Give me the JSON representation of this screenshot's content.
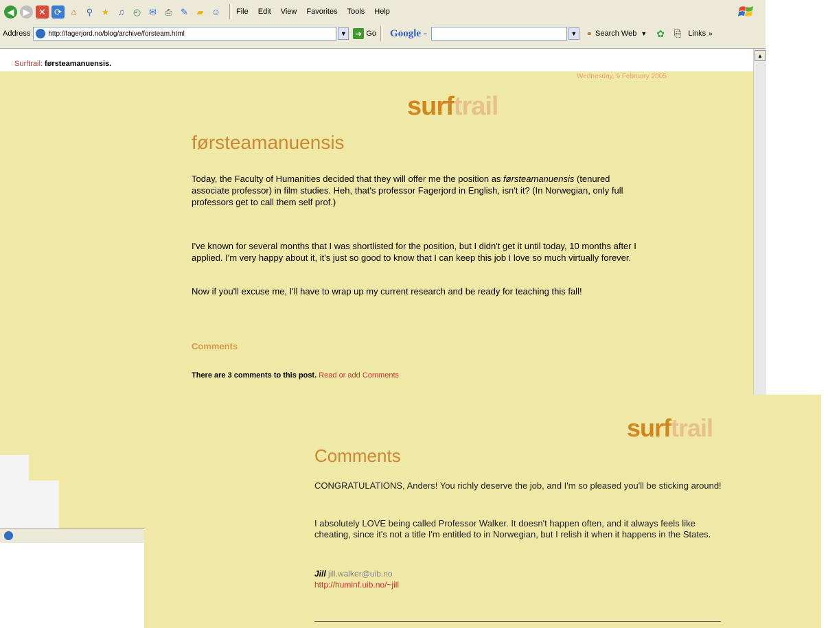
{
  "browser": {
    "menu": [
      "File",
      "Edit",
      "View",
      "Favorites",
      "Tools",
      "Help"
    ],
    "address_label": "Address",
    "address_url": "http://fagerjord.no/blog/archive/forsteam.html",
    "go_label": "Go",
    "google_label": "Google -",
    "search_web_label": "Search Web",
    "links_label": "Links"
  },
  "page": {
    "breadcrumb_site": "Surftrail:",
    "breadcrumb_page": "førsteamanuensis.",
    "date": "Wednesday, 9 February 2005",
    "logo_part1": "surf",
    "logo_part2": "trail",
    "post_title": "førsteamanuensis",
    "p1_before": "Today, the Faculty of Humanities decided that they will offer me the position as ",
    "p1_italic": "førsteamanuensis",
    "p1_after": " (tenured associate professor) in film studies. Heh, that's professor Fagerjord in English, isn't it? (In Norwegian, only full professors get to call them self prof.)",
    "p2": "I've known for several months that I was shortlisted for the position, but I didn't get it until today, 10 months after I applied. I'm very happy about it, it's just so good to know that I can keep this job I love so much virtually forever.",
    "p3": "Now if you'll excuse me, I'll have to wrap up my current research and be ready for teaching this fall!",
    "comments_heading": "Comments",
    "comment_count_text": "There are 3 comments to this post.",
    "comment_link": "Read or add Comments"
  },
  "comments_window": {
    "logo_part1": "surf",
    "logo_part2": "trail",
    "title": "Comments",
    "comment1": "CONGRATULATIONS, Anders! You richly deserve the job, and I'm so pleased you'll be sticking around!",
    "comment2": "I absolutely LOVE being called Professor Walker. It doesn't happen often, and it always feels like cheating, since it's not a title I'm entitled to in Norwegian, but I relish it when it happens in the States.",
    "author_name": "Jill",
    "author_email": "jill.walker@uib.no",
    "author_url": "http://huminf.uib.no/~jill"
  },
  "colors": {
    "page_background": "#efe8a7",
    "title_orange": "#cd8932",
    "link_red": "#cc3333"
  }
}
